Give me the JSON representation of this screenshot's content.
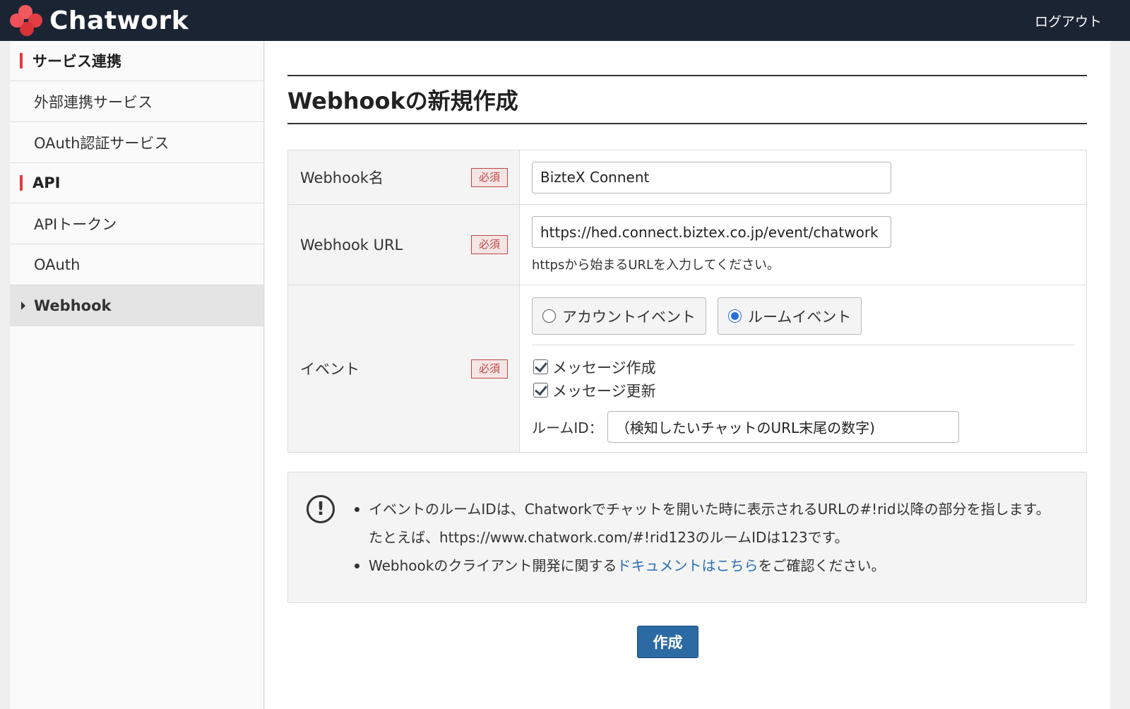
{
  "header": {
    "brand": "Chatwork",
    "logout_label": "ログアウト"
  },
  "sidebar": {
    "sections": [
      {
        "heading": "サービス連携",
        "items": [
          {
            "label": "外部連携サービス",
            "active": false
          },
          {
            "label": "OAuth認証サービス",
            "active": false
          }
        ]
      },
      {
        "heading": "API",
        "items": [
          {
            "label": "APIトークン",
            "active": false
          },
          {
            "label": "OAuth",
            "active": false
          },
          {
            "label": "Webhook",
            "active": true
          }
        ]
      }
    ]
  },
  "page": {
    "title": "Webhookの新規作成"
  },
  "form": {
    "required_label": "必須",
    "webhook_name": {
      "label": "Webhook名",
      "value": "BizteX Connent"
    },
    "webhook_url": {
      "label": "Webhook URL",
      "value": "https://hed.connect.biztex.co.jp/event/chatwork",
      "help": "httpsから始まるURLを入力してください。"
    },
    "event": {
      "label": "イベント",
      "options": [
        {
          "label": "アカウントイベント",
          "selected": false
        },
        {
          "label": "ルームイベント",
          "selected": true
        }
      ],
      "checks": [
        {
          "label": "メッセージ作成",
          "checked": true
        },
        {
          "label": "メッセージ更新",
          "checked": true
        }
      ],
      "room_id_label": "ルームID：",
      "room_id_value": "（検知したいチャットのURL末尾の数字)"
    }
  },
  "info": {
    "line1": "イベントのルームIDは、Chatworkでチャットを開いた時に表示されるURLの#!rid以降の部分を指します。たとえば、https://www.chatwork.com/#!rid123のルームIDは123です。",
    "line2_before": "Webhookのクライアント開発に関する",
    "line2_link": "ドキュメントはこちら",
    "line2_after": "をご確認ください。"
  },
  "submit_label": "作成",
  "colors": {
    "header_bg": "#1b2433",
    "brand_red": "#e8383d",
    "primary_button": "#2b6aa3",
    "link": "#2a6fb6",
    "radio_selected": "#2a6edb"
  }
}
